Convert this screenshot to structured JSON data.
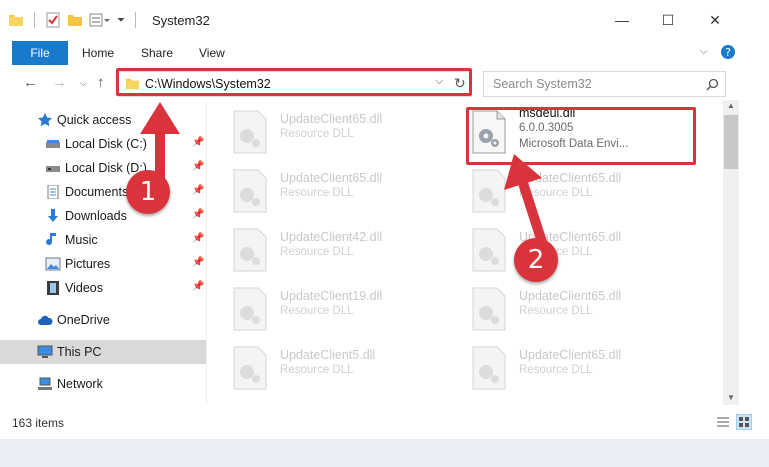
{
  "window": {
    "title": "System32",
    "minimize": "—",
    "maximize": "☐",
    "close": "✕"
  },
  "ribbon": {
    "tabs": [
      "File",
      "Home",
      "Share",
      "View"
    ]
  },
  "address": {
    "path": "C:\\Windows\\System32",
    "search_placeholder": "Search System32"
  },
  "sidebar": {
    "items": [
      {
        "label": "Quick access",
        "pinned": false
      },
      {
        "label": "Local Disk (C:)",
        "pinned": true
      },
      {
        "label": "Local Disk (D:)",
        "pinned": true
      },
      {
        "label": "Documents",
        "pinned": true
      },
      {
        "label": "Downloads",
        "pinned": true
      },
      {
        "label": "Music",
        "pinned": true
      },
      {
        "label": "Pictures",
        "pinned": true
      },
      {
        "label": "Videos",
        "pinned": true
      },
      {
        "label": "OneDrive",
        "pinned": false
      },
      {
        "label": "This PC",
        "pinned": false
      },
      {
        "label": "Network",
        "pinned": false
      }
    ]
  },
  "files": {
    "left_column": [
      {
        "name": "UpdateClient65.dll",
        "desc": "Resource DLL"
      },
      {
        "name": "UpdateClient65.dll",
        "desc": "Resource DLL"
      },
      {
        "name": "UpdateClient42.dll",
        "desc": "Resource DLL"
      },
      {
        "name": "UpdateClient19.dll",
        "desc": "Resource DLL"
      },
      {
        "name": "UpdateClient5.dll",
        "desc": "Resource DLL"
      }
    ],
    "right_column": [
      {
        "name": "msdeui.dll",
        "version": "6.0.0.3005",
        "desc": "Microsoft Data Envi..."
      },
      {
        "name": "UpdateClient65.dll",
        "desc": "Resource DLL"
      },
      {
        "name": "UpdateClient65.dll",
        "desc": "Resource DLL"
      },
      {
        "name": "UpdateClient65.dll",
        "desc": "Resource DLL"
      },
      {
        "name": "UpdateClient65.dll",
        "desc": "Resource DLL"
      }
    ]
  },
  "status": {
    "item_count": "163 items"
  },
  "annotations": {
    "step1": "1",
    "step2": "2",
    "accent_color": "#d9343c"
  }
}
